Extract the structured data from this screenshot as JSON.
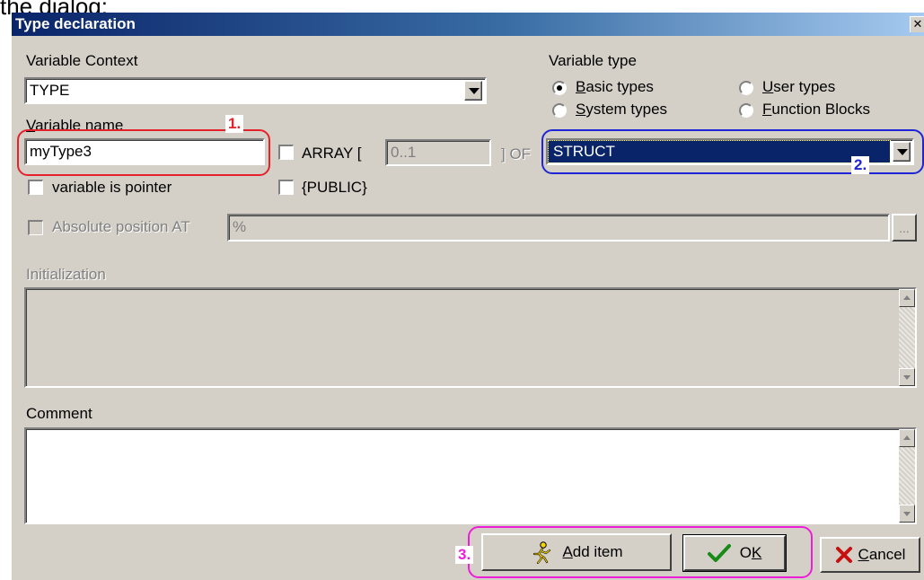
{
  "top_cutoff_text": "the dialog:",
  "window": {
    "title": "Type declaration",
    "close_glyph": "✕"
  },
  "variable_context": {
    "label": "Variable Context",
    "value": "TYPE"
  },
  "variable_name": {
    "label": "Variable name",
    "value": "myType3"
  },
  "array": {
    "label": "ARRAY [",
    "range": "0..1",
    "of_label": "] OF"
  },
  "variable_type": {
    "label": "Variable type",
    "options": [
      {
        "accel": "B",
        "rest": "asic types",
        "selected": true
      },
      {
        "accel": "U",
        "rest": "ser types",
        "selected": false
      },
      {
        "accel": "S",
        "rest": "ystem types",
        "selected": false
      },
      {
        "accel": "F",
        "rest": "unction Blocks",
        "selected": false
      }
    ],
    "selected_type": "STRUCT"
  },
  "pointer_checkbox": {
    "label": "variable is pointer",
    "checked": false
  },
  "public_checkbox": {
    "label": "{PUBLIC}",
    "checked": false
  },
  "absolute_position": {
    "label": "Absolute position AT",
    "value": "%",
    "browse_label": "..."
  },
  "initialization": {
    "label": "Initialization",
    "value": ""
  },
  "comment": {
    "label": "Comment",
    "value": ""
  },
  "buttons": {
    "add_item": {
      "accel": "A",
      "rest": "dd item"
    },
    "ok": {
      "label": "O",
      "accel": "K"
    },
    "cancel": {
      "accel": "C",
      "rest": "ancel"
    }
  },
  "callouts": {
    "one": "1.",
    "two": "2.",
    "three": "3."
  },
  "colors": {
    "callout_red": "#e5222c",
    "callout_blue": "#1f25d6",
    "callout_magenta": "#ee1ed8",
    "selection_navy": "#0a246a",
    "dialog_face": "#d4d0c8",
    "ok_check_green": "#178a17",
    "cancel_x_red": "#c81010"
  },
  "icons": {
    "add_item": "running-man-icon",
    "ok": "checkmark-icon",
    "cancel": "red-x-icon",
    "dropdown": "chevron-down-icon"
  }
}
